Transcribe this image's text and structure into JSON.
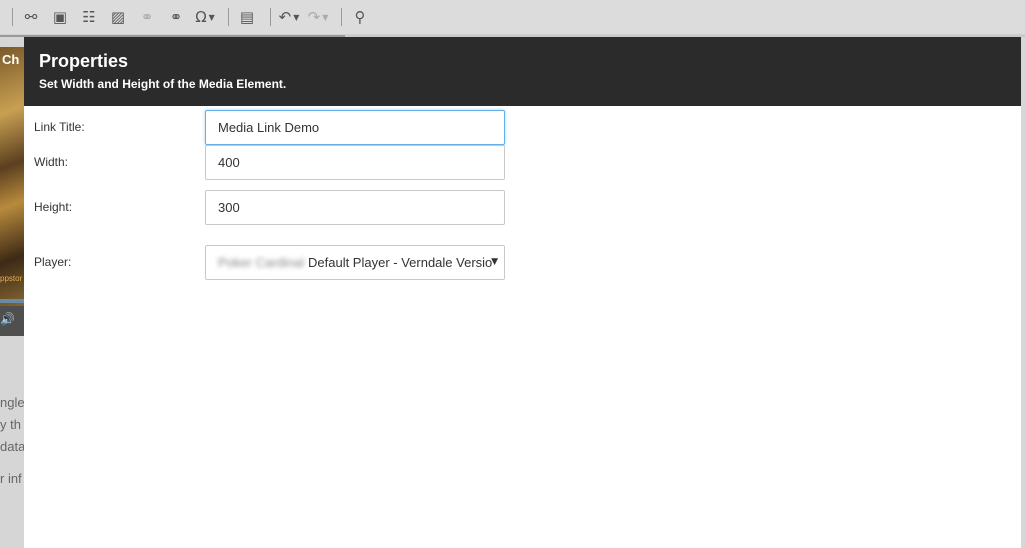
{
  "toolbar": {
    "buttons": [
      {
        "name": "insert-link-icon",
        "glyph": "⚯"
      },
      {
        "name": "insert-media-icon",
        "glyph": "▣"
      },
      {
        "name": "insert-table-icon",
        "glyph": "☷"
      },
      {
        "name": "insert-image-icon",
        "glyph": "▨"
      },
      {
        "name": "link-disabled-icon",
        "glyph": "⚭"
      },
      {
        "name": "unlink-icon",
        "glyph": "⚭"
      },
      {
        "name": "special-character-icon",
        "glyph": "Ω"
      },
      {
        "name": "paste-from-word-icon",
        "glyph": "▤"
      },
      {
        "name": "undo-icon",
        "glyph": "↶"
      },
      {
        "name": "redo-icon",
        "glyph": "↷"
      },
      {
        "name": "find-icon",
        "glyph": "⚲"
      }
    ]
  },
  "background": {
    "title_fragment": "Ch",
    "image_caption": "ppstor",
    "text_lines": [
      "ngle",
      "y th",
      "data",
      "r inf"
    ]
  },
  "dialog": {
    "title": "Properties",
    "subtitle": "Set Width and Height of the Media Element.",
    "link_title": {
      "label": "Link Title:",
      "value": "Media Link Demo"
    },
    "width": {
      "label": "Width:",
      "value": "400"
    },
    "height": {
      "label": "Height:",
      "value": "300"
    },
    "player": {
      "label": "Player:",
      "value": "Default Player - Verndale Versio",
      "blurred_prefix": "Poker Cardinal"
    }
  },
  "colors": {
    "header_bg": "#2b2b2b",
    "focus_border": "#66afe9"
  }
}
